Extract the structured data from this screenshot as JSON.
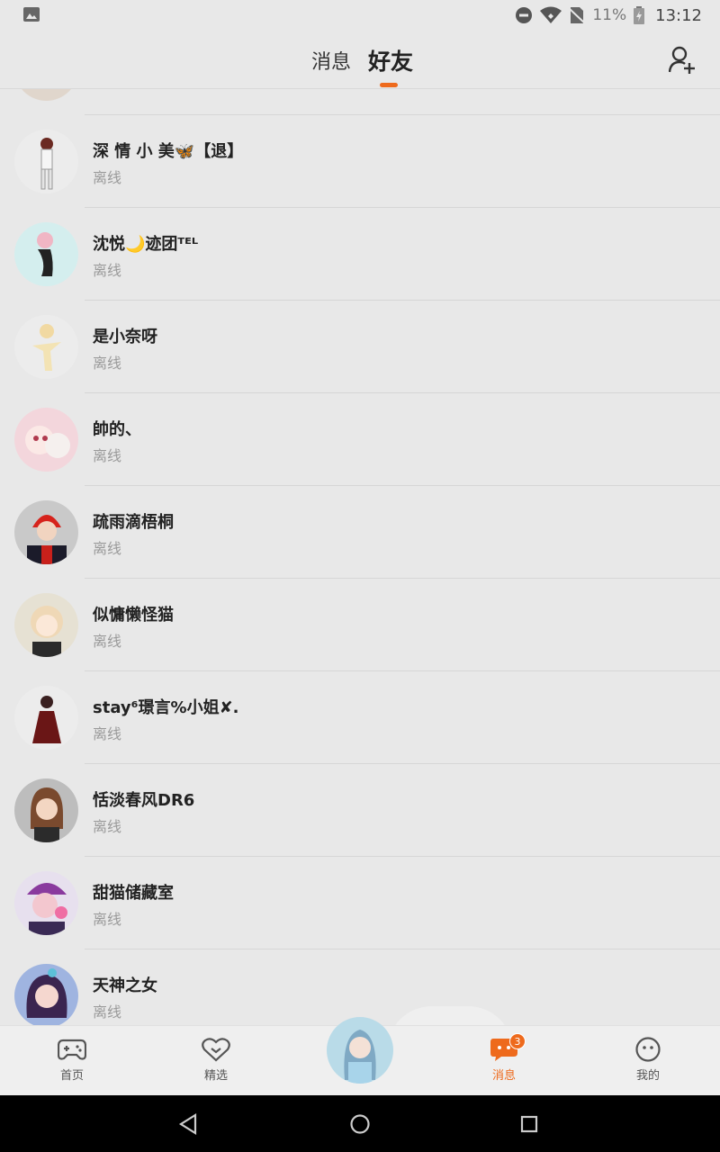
{
  "status_bar": {
    "battery": "11%",
    "time": "13:12",
    "icons": [
      "image-icon",
      "do-not-disturb-icon",
      "wifi-icon",
      "no-sim-icon",
      "battery-icon"
    ]
  },
  "header": {
    "tabs": [
      {
        "label": "消息",
        "active": false
      },
      {
        "label": "好友",
        "active": true
      }
    ],
    "accent_color": "#ee6a1c",
    "add_friend_icon": "add-user-icon"
  },
  "friends": [
    {
      "name": "深 情 小 美🦋【退】",
      "status": "离线"
    },
    {
      "name": "沈悦🌙迹团ᵀᴱᴸ",
      "status": "离线"
    },
    {
      "name": "是小奈呀",
      "status": "离线"
    },
    {
      "name": "帥的、",
      "status": "离线"
    },
    {
      "name": "疏雨滴梧桐",
      "status": "离线"
    },
    {
      "name": "似慵懒怪猫",
      "status": "离线"
    },
    {
      "name": "stay⁶璟言%小姐✘.",
      "status": "离线"
    },
    {
      "name": "恬淡春风DR6",
      "status": "离线"
    },
    {
      "name": "甜猫储藏室",
      "status": "离线"
    },
    {
      "name": "天神之女",
      "status": "离线"
    }
  ],
  "bottom_nav": {
    "items": [
      {
        "label": "首页",
        "icon": "gamepad-icon"
      },
      {
        "label": "精选",
        "icon": "heart-icon"
      },
      {
        "label": "消息",
        "icon": "chat-bubble-icon",
        "badge": "3",
        "active": true
      },
      {
        "label": "我的",
        "icon": "smiley-icon"
      }
    ]
  }
}
